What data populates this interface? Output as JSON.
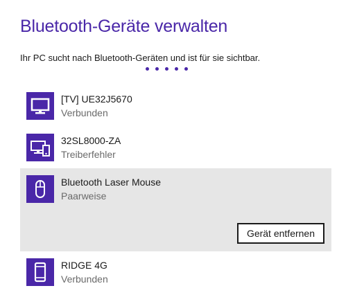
{
  "page": {
    "title": "Bluetooth-Geräte verwalten",
    "subtitle": "Ihr PC sucht nach Bluetooth-Geräten und ist für sie sichtbar."
  },
  "colors": {
    "accent": "#4a27a8",
    "selected_background": "#e6e6e6"
  },
  "devices": [
    {
      "name": "[TV] UE32J5670",
      "status": "Verbunden",
      "icon": "monitor-icon"
    },
    {
      "name": "32SL8000-ZA",
      "status": "Treiberfehler",
      "icon": "devices-icon"
    },
    {
      "name": "Bluetooth Laser Mouse",
      "status": "Paarweise",
      "icon": "mouse-icon",
      "selected": true,
      "action_label": "Gerät entfernen"
    },
    {
      "name": "RIDGE 4G",
      "status": "Verbunden",
      "icon": "phone-icon"
    }
  ]
}
